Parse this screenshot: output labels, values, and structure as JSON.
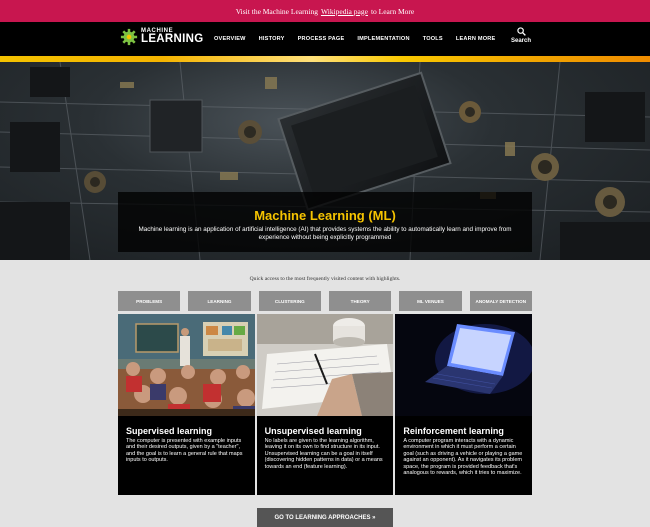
{
  "banner": {
    "prefix": "Visit the Machine Learning",
    "link": "Wikipedia page",
    "suffix": "to Learn More"
  },
  "logo": {
    "line1": "MACHINE",
    "line2": "LEARNING"
  },
  "nav": {
    "items": [
      "OVERVIEW",
      "HISTORY",
      "PROCESS PAGE",
      "IMPLEMENTATION",
      "TOOLS",
      "LEARN MORE"
    ],
    "search_label": "Search"
  },
  "hero": {
    "title": "Machine Learning (ML)",
    "description": "Machine learning is an application of artificial intelligence (AI) that provides systems the ability to automatically learn and improve from experience without being explicitly programmed"
  },
  "quick_access": "Quick access to the most frequently visited content with highlights.",
  "tabs": [
    "PROBLEMS",
    "LEARNING",
    "CLUSTERING",
    "THEORY",
    "ML VENUES",
    "ANOMALY DETECTION"
  ],
  "cards": [
    {
      "title": "Supervised learning",
      "text": "The computer is presented with example inputs and their desired outputs, given by a \"teacher\", and the goal is to learn a general rule that maps inputs to outputs."
    },
    {
      "title": "Unsupervised learning",
      "text": "No labels are given to the learning algorithm, leaving it on its own to find structure in its input. Unsupervised learning can be a goal in itself (discovering hidden patterns in data) or a means towards an end (feature learning)."
    },
    {
      "title": "Reinforcement learning",
      "text": "A computer program interacts with a dynamic environment in which it must perform a certain goal (such as driving a vehicle or playing a game against an opponent). As it navigates its problem space, the program is provided feedback that's analogous to rewards, which it tries to maximize."
    }
  ],
  "cta": "GO TO LEARNING APPROACHES »",
  "colors": {
    "banner": "#c8164f",
    "accent": "#f6c400",
    "nav": "#000000",
    "tab": "#8f8f8f"
  },
  "icons": {
    "logo": "gear-logo-icon",
    "search": "search-icon"
  }
}
